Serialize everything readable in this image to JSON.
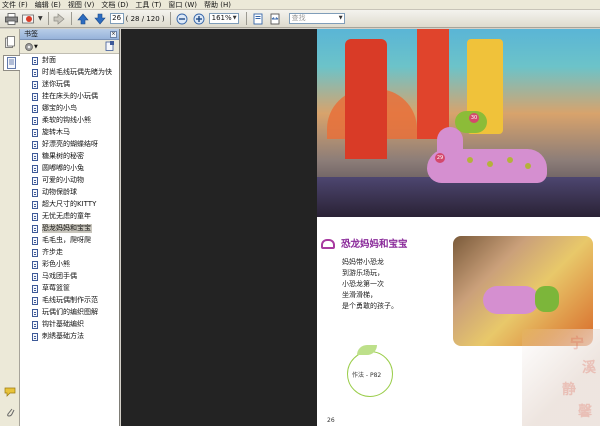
{
  "menubar": [
    "文件 (F)",
    "编辑 (E)",
    "视图 (V)",
    "文档 (D)",
    "工具 (T)",
    "窗口 (W)",
    "帮助 (H)"
  ],
  "toolbar": {
    "page_current": "26",
    "page_count": "( 28 / 120 )",
    "zoom": "161%",
    "search_placeholder": "查找"
  },
  "bookmarks": {
    "title": "书签",
    "items": [
      "封面",
      "时尚毛线玩偶先睹为快",
      "迷你玩偶",
      "挂在床头的小玩偶",
      "娜宝的小鸟",
      "柔软的钩线小熊",
      "旋转木马",
      "好漂亮的蝴蝶结呀",
      "糖果树的秘密",
      "圆嘟嘟的小兔",
      "可爱的小动物",
      "动物保龄球",
      "超大尺寸的KITTY",
      "无忧无虑的童年",
      "恐龙妈妈和宝宝",
      "毛毛虫，爬呀爬",
      "齐步走",
      "彩色小熊",
      "马戏团手偶",
      "草莓篮筐",
      "毛线玩偶制作示范",
      "玩偶们的编织图解",
      "钩针基础编织",
      "刺绣基础方法"
    ],
    "selected_index": 14
  },
  "page": {
    "badge_top": "30",
    "badge_bottom": "29",
    "section_title": "恐龙妈妈和宝宝",
    "poem": [
      "妈妈带小恐龙",
      "到游乐场玩，",
      "小恐龙第一次",
      "坐滑滑梯，",
      "是个勇敢的孩子。"
    ],
    "recipe_ref": "作法 - P82",
    "page_number": "26",
    "watermark_chars": [
      "宁",
      "溪",
      "静",
      "馨"
    ]
  },
  "colors": {
    "accent_title": "#8a2a9a",
    "doc_background": "#232323",
    "bookmark_header": "#97b3da"
  }
}
